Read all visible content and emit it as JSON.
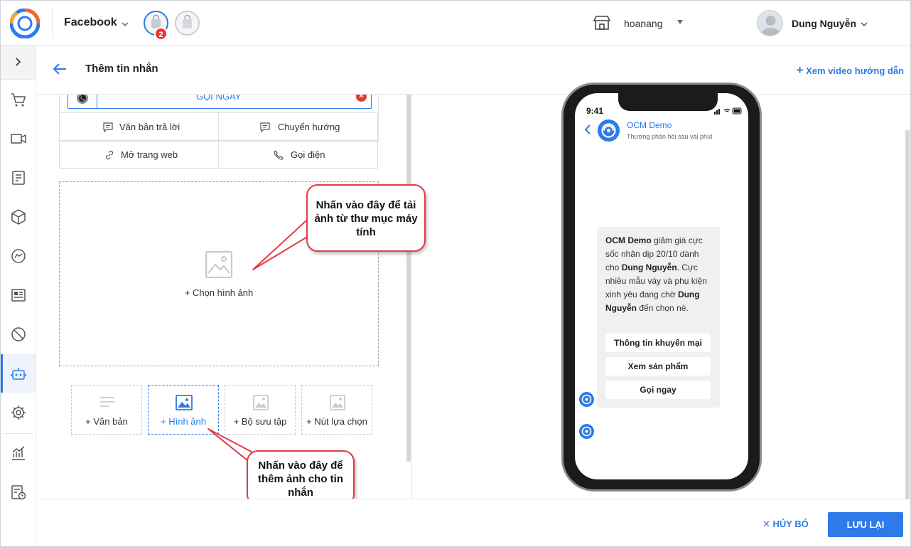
{
  "topbar": {
    "channel": "Facebook",
    "notification_count": "2",
    "store_name": "hoanang",
    "user_name": "Dung Nguyễn"
  },
  "page": {
    "title": "Thêm tin nhắn",
    "guide_link": "Xem video hướng dẫn"
  },
  "editor": {
    "call_button_label": "GỌI NGAY",
    "button_types": {
      "reply_text": "Văn bản trả lời",
      "redirect": "Chuyển hướng",
      "open_web": "Mở trang web",
      "call": "Gọi điện"
    },
    "choose_image": "+ Chọn hình ảnh",
    "add_types": {
      "text": "+ Văn bản",
      "image": "+ Hình ảnh",
      "gallery": "+ Bộ sưu tập",
      "choice_button": "+ Nút lựa chọn"
    }
  },
  "callouts": {
    "upload_hint": "Nhấn vào đây để tải ảnh từ thư mục máy tính",
    "add_image_hint": "Nhấn vào đây để thêm ảnh cho tin nhắn"
  },
  "preview": {
    "time": "9:41",
    "page_name": "OCM Demo",
    "page_status": "Thường phản hồi sau vài phút",
    "message": {
      "p1_bold": "OCM Demo",
      "p1_text": " giảm giá cực sốc nhân dịp 20/10 dành cho ",
      "p2_bold": "Dung Nguyễn",
      "p2_text": ". Cực nhiều mẫu váy và phụ kiện xinh yêu đang chờ ",
      "p3_bold": "Dung Nguyễn",
      "p3_text": " đến chọn nè."
    },
    "quick_replies": [
      "Thông tin khuyến mại",
      "Xem sản phẩm",
      "Gọi ngay"
    ]
  },
  "footer": {
    "cancel": "HỦY BỎ",
    "save": "LƯU LẠI"
  },
  "colors": {
    "accent": "#2d7ae8",
    "callout_border": "#e53945",
    "badge": "#e53935"
  }
}
